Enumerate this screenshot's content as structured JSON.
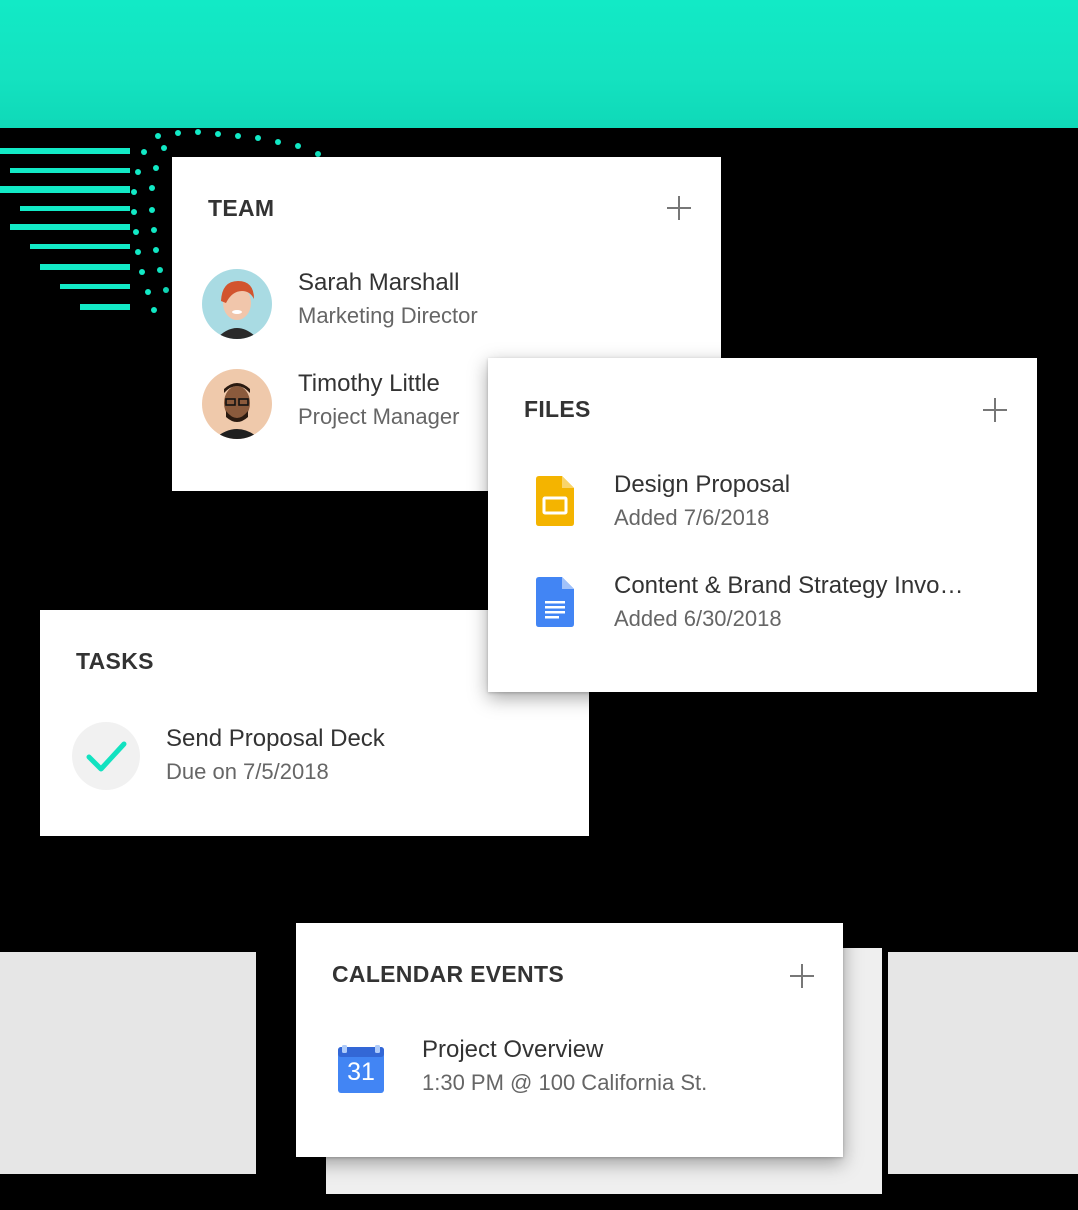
{
  "team": {
    "title": "TEAM",
    "members": [
      {
        "name": "Sarah Marshall",
        "role": "Marketing Director"
      },
      {
        "name": "Timothy Little",
        "role": "Project Manager"
      }
    ]
  },
  "files": {
    "title": "FILES",
    "items": [
      {
        "name": "Design Proposal",
        "meta": "Added 7/6/2018",
        "icon": "google-slides-icon"
      },
      {
        "name": "Content & Brand Strategy Invo…",
        "meta": "Added 6/30/2018",
        "icon": "google-docs-icon"
      }
    ]
  },
  "tasks": {
    "title": "TASKS",
    "items": [
      {
        "name": "Send Proposal Deck",
        "meta": "Due on 7/5/2018"
      }
    ]
  },
  "calendar": {
    "title": "CALENDAR EVENTS",
    "items": [
      {
        "name": "Project Overview",
        "meta": "1:30 PM @ 100 California St.",
        "day": "31"
      }
    ]
  },
  "colors": {
    "accent": "#12eac6",
    "slides": "#f4b400",
    "docs": "#4285f4"
  }
}
